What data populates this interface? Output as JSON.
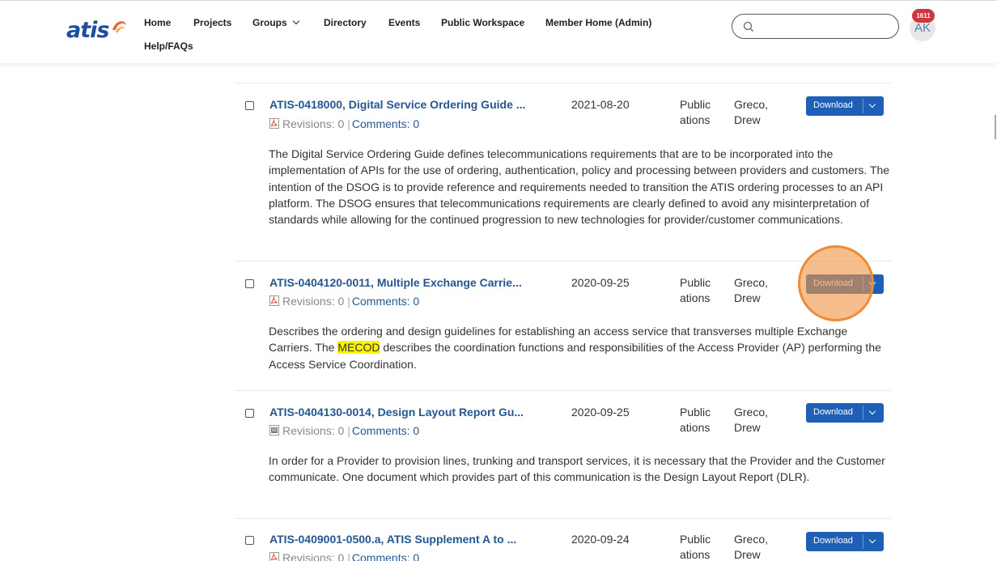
{
  "header": {
    "logo_text": "atis",
    "nav": [
      "Home",
      "Projects",
      "Groups",
      "Directory",
      "Events",
      "Public Workspace",
      "Member Home (Admin)",
      "Help/FAQs"
    ],
    "search_placeholder": "",
    "notification_count": "1611",
    "avatar_initials": "AK"
  },
  "records": [
    {
      "title": "ATIS-0418000, Digital Service Ordering Guide ...",
      "file_icon": "pdf-icon",
      "revisions": "Revisions: 0",
      "comments": "Comments: 0",
      "date": "2021-08-20",
      "type": "Publications",
      "author": "Greco, Drew",
      "download": "Download",
      "description": "The Digital Service Ordering Guide defines telecommunications requirements that are to be incorporated into the implementation of APIs for the use of ordering, authentication, policy and processing between providers and customers. The intention of the DSOG is to provide reference and requirements needed to transition the ATIS ordering processes to an API platform. The DSOG ensures that telecommunications requirements are clearly defined to avoid any misinterpretation of standards while allowing for the continued progression to new technologies for provider/customer communications."
    },
    {
      "title": "ATIS-0404120-0011, Multiple Exchange Carrie...",
      "file_icon": "pdf-icon",
      "revisions": "Revisions: 0",
      "comments": "Comments: 0",
      "date": "2020-09-25",
      "type": "Publications",
      "author": "Greco, Drew",
      "download": "Download",
      "description_pre": "Describes the ordering and design guidelines for establishing an access service that transverses multiple Exchange Carriers. The ",
      "description_highlight": "MECOD",
      "description_post": " describes the coordination functions and responsibilities of the Access Provider (AP) performing the Access Service Coordination."
    },
    {
      "title": "ATIS-0404130-0014, Design Layout Report Gu...",
      "file_icon": "word-doc-icon",
      "revisions": "Revisions: 0",
      "comments": "Comments: 0",
      "date": "2020-09-25",
      "type": "Publications",
      "author": "Greco, Drew",
      "download": "Download",
      "description": "In order for a Provider to provision lines, trunking and transport services, it is necessary that the Provider and the Customer communicate. One document which provides part of this communication is the Design Layout Report (DLR)."
    },
    {
      "title": "ATIS-0409001-0500.a, ATIS Supplement A to ...",
      "file_icon": "pdf-icon",
      "revisions": "Revisions: 0",
      "comments": "Comments: 0",
      "date": "2020-09-24",
      "type": "Publications",
      "author": "Greco, Drew",
      "download": "Download"
    }
  ],
  "colors": {
    "link": "#24578f",
    "button": "#1f5fb6",
    "badge": "#d0363a",
    "highlight": "#fff200",
    "click_marker": "#ee8b3a"
  }
}
